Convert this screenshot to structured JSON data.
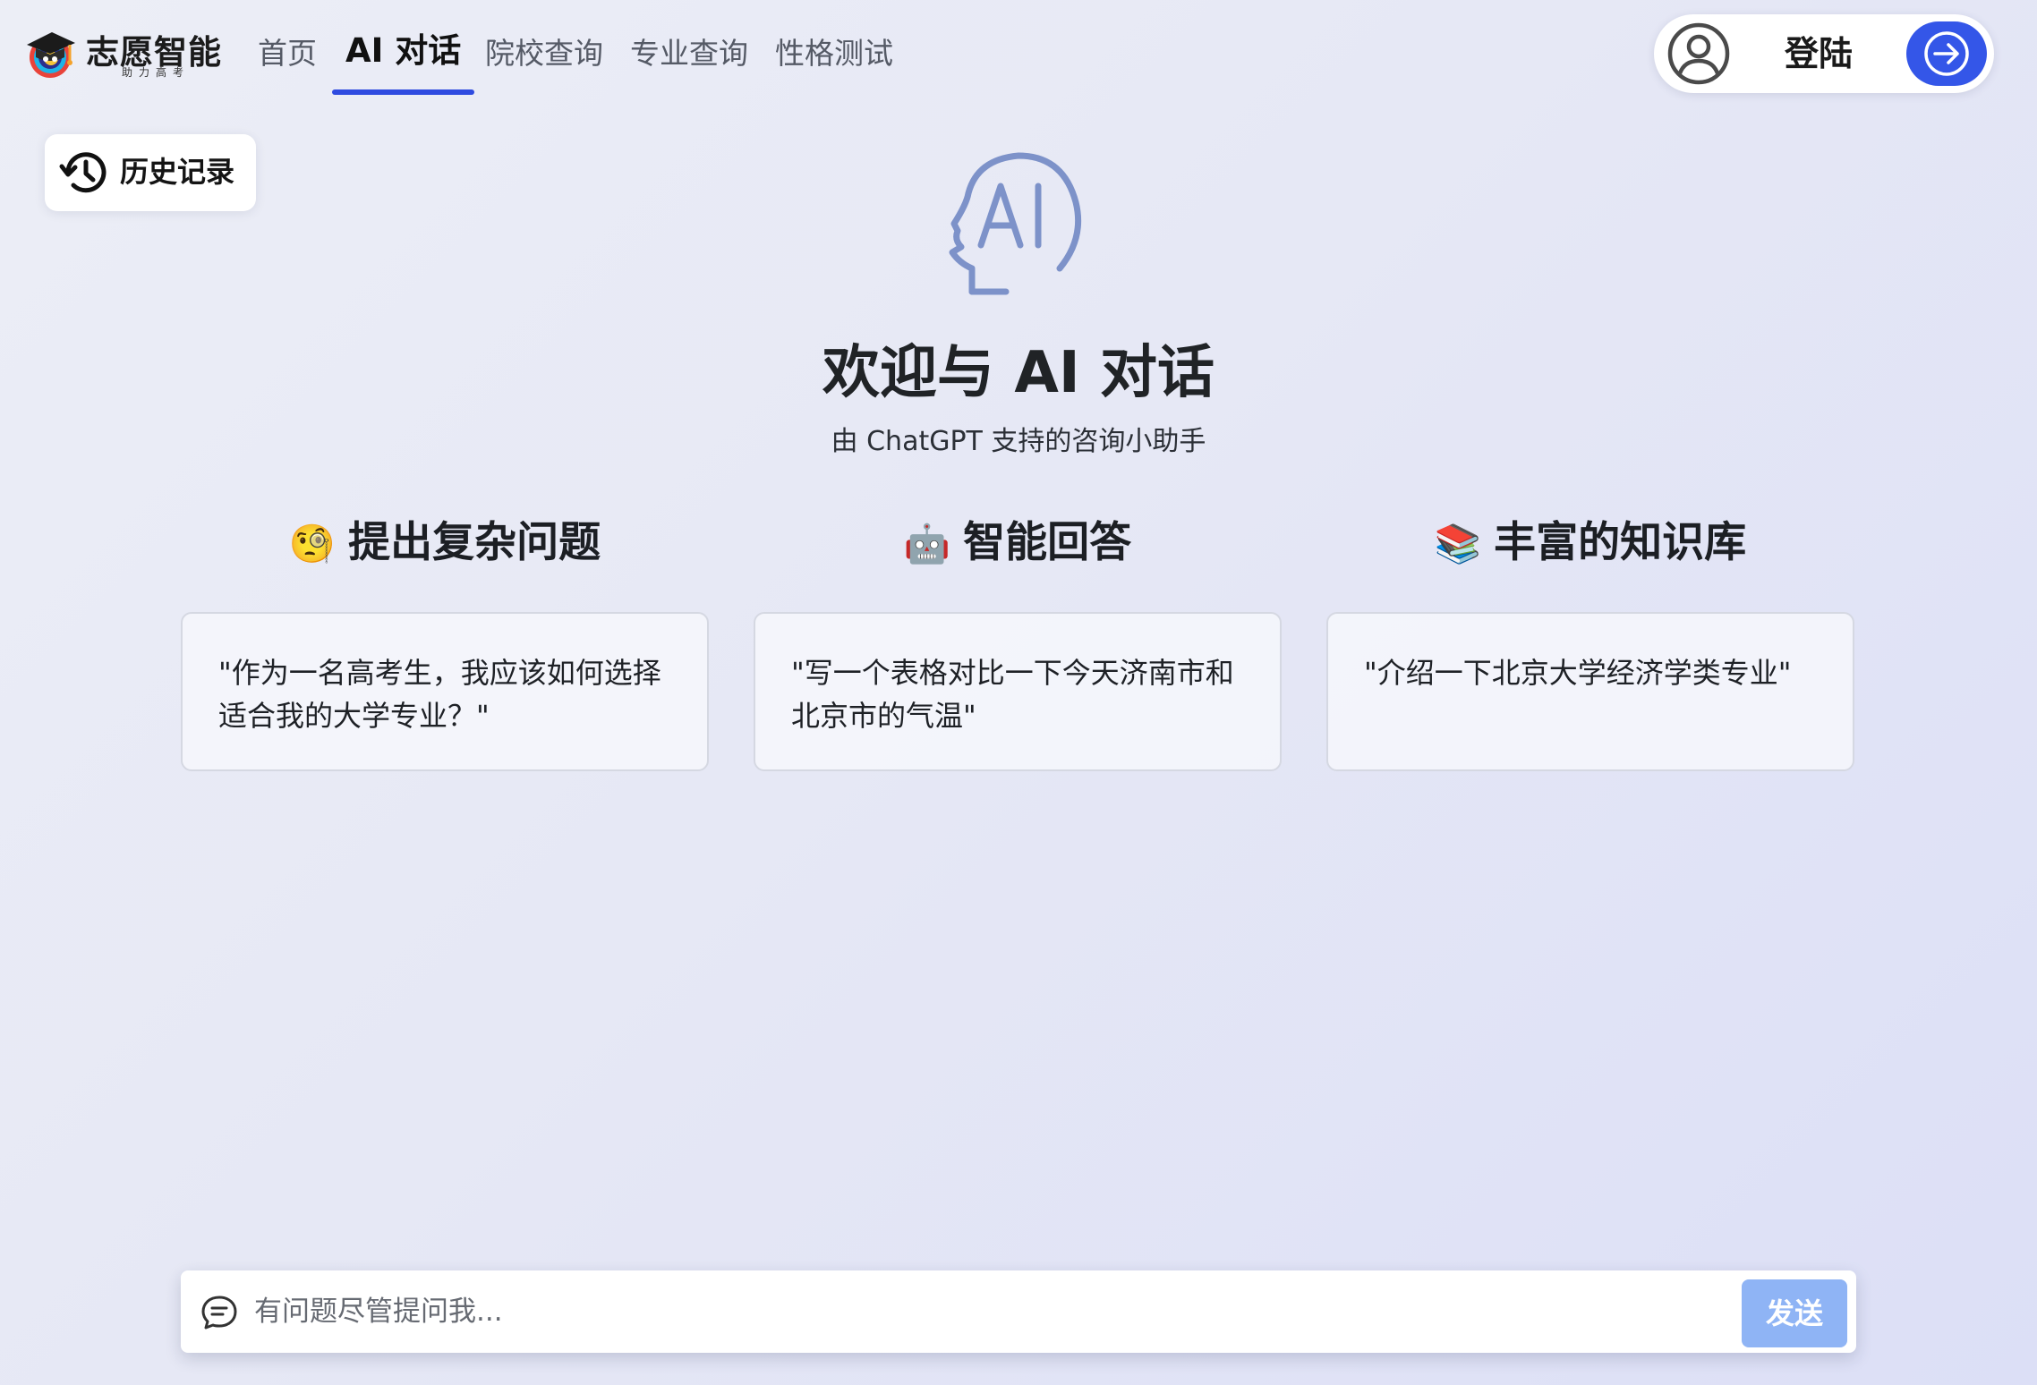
{
  "header": {
    "logo": {
      "title": "志愿智能",
      "subtitle": "助力高考"
    },
    "nav": [
      {
        "label": "首页",
        "active": false
      },
      {
        "label": "AI 对话",
        "active": true
      },
      {
        "label": "院校查询",
        "active": false
      },
      {
        "label": "专业查询",
        "active": false
      },
      {
        "label": "性格测试",
        "active": false
      }
    ],
    "login_label": "登陆"
  },
  "history": {
    "label": "历史记录"
  },
  "hero": {
    "icon": "ai-head-icon",
    "title": "欢迎与 AI 对话",
    "subtitle": "由 ChatGPT 支持的咨询小助手"
  },
  "features": [
    {
      "emoji": "🧐",
      "title": "提出复杂问题",
      "example": "\"作为一名高考生，我应该如何选择适合我的大学专业？\""
    },
    {
      "emoji": "🤖",
      "title": "智能回答",
      "example": "\"写一个表格对比一下今天济南市和北京市的气温\""
    },
    {
      "emoji": "📚",
      "title": "丰富的知识库",
      "example": "\"介绍一下北京大学经济学类专业\""
    }
  ],
  "chat": {
    "placeholder": "有问题尽管提问我...",
    "value": "",
    "send_label": "发送"
  },
  "colors": {
    "accent": "#3456e8",
    "nav_underline": "#2f4be0",
    "send_button": "#8fb4f5",
    "icon_blue": "#7d92c9"
  }
}
